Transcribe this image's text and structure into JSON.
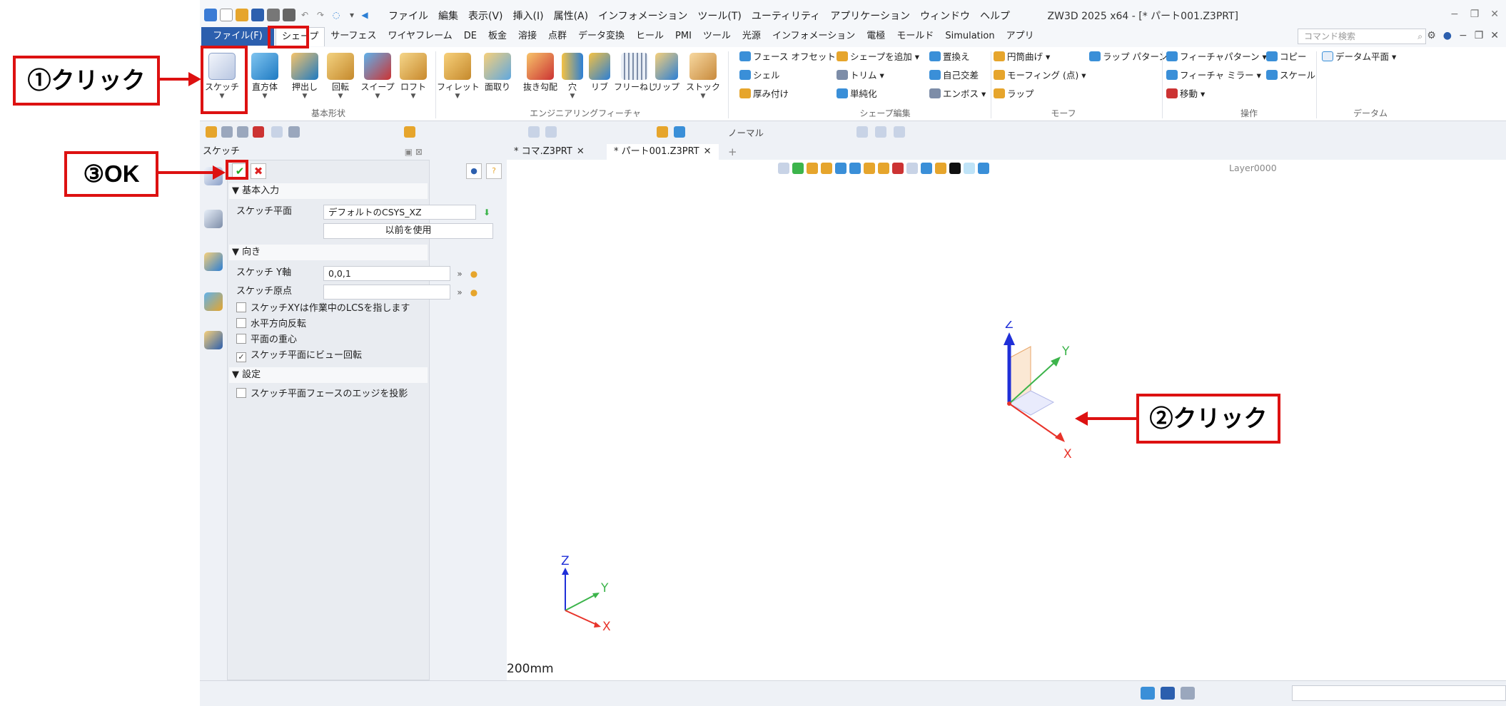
{
  "app": {
    "title": "ZW3D 2025 x64 - [* パート001.Z3PRT]",
    "menu": [
      "ファイル",
      "編集",
      "表示(V)",
      "挿入(I)",
      "属性(A)",
      "インフォメーション",
      "ツール(T)",
      "ユーティリティ",
      "アプリケーション",
      "ウィンドウ",
      "ヘルプ"
    ],
    "window_controls": [
      "−",
      "❐",
      "✕"
    ]
  },
  "ribbon_tabs": {
    "file": "ファイル(F)",
    "tabs": [
      "シェープ",
      "サーフェス",
      "ワイヤフレーム",
      "DE",
      "板金",
      "溶接",
      "点群",
      "データ変換",
      "ヒール",
      "PMI",
      "ツール",
      "光源",
      "インフォメーション",
      "電極",
      "モールド",
      "Simulation",
      "アプリ"
    ],
    "active_index": 0,
    "search_placeholder": "コマンド検索"
  },
  "ribbon": {
    "basic": {
      "buttons": [
        "スケッチ",
        "直方体",
        "押出し",
        "回転",
        "スイープ",
        "ロフト"
      ],
      "group_label": "基本形状"
    },
    "engineering": {
      "buttons": [
        "フィレット",
        "面取り",
        "抜き勾配",
        "穴",
        "リブ",
        "フリーねじ",
        "リップ",
        "ストック"
      ],
      "group_label": "エンジニアリングフィーチャ"
    },
    "shape_edit": {
      "items": [
        "フェース オフセット",
        "シェル",
        "厚み付け",
        "シェープを追加",
        "トリム",
        "単純化",
        "置換え",
        "自己交差",
        "エンボス"
      ],
      "group_label": "シェープ編集"
    },
    "morph": {
      "items": [
        "円筒曲げ",
        "モーフィング (点)",
        "ラップ",
        "ラップ パターン"
      ],
      "group_label": "モーフ"
    },
    "operation": {
      "items": [
        "フィーチャパターン",
        "フィーチャ ミラー",
        "移動",
        "コピー",
        "スケール"
      ],
      "group_label": "操作"
    },
    "datum": {
      "items": [
        "データム平面"
      ],
      "group_label": "データム"
    }
  },
  "toolbar": {
    "display_mode": "ノーマル"
  },
  "panel": {
    "title": "スケッチ",
    "ok_label": "✔",
    "cancel_label": "✖",
    "sections": {
      "basic_input": "基本入力",
      "orientation": "向き",
      "settings": "設定"
    },
    "fields": {
      "sketch_plane_label": "スケッチ平面",
      "sketch_plane_value": "デフォルトのCSYS_XZ",
      "use_previous": "以前を使用",
      "y_axis_label": "スケッチ Y軸",
      "y_axis_value": "0,0,1",
      "origin_label": "スケッチ原点",
      "origin_value": ""
    },
    "checkboxes": [
      {
        "label": "スケッチXYは作業中のLCSを指します",
        "checked": false
      },
      {
        "label": "水平方向反転",
        "checked": false
      },
      {
        "label": "平面の重心",
        "checked": false
      },
      {
        "label": "スケッチ平面にビュー回転",
        "checked": true
      }
    ],
    "settings_checkbox": {
      "label": "スケッチ平面フェースのエッジを投影",
      "checked": false
    }
  },
  "document_tabs": [
    {
      "label": "* コマ.Z3PRT",
      "active": false
    },
    {
      "label": "* パート001.Z3PRT",
      "active": true
    }
  ],
  "viewport": {
    "layer": "Layer0000",
    "scale_label": "200mm",
    "axis_labels": {
      "x": "X",
      "y": "Y",
      "z": "Z"
    }
  },
  "callouts": {
    "step1": "①クリック",
    "step2": "②クリック",
    "step3": "③OK"
  },
  "colors": {
    "callout_red": "#dd1111",
    "file_tab_blue": "#2c5fae",
    "axis_x": "#e8332a",
    "axis_y": "#3cb44b",
    "axis_z": "#1f2fd8"
  }
}
